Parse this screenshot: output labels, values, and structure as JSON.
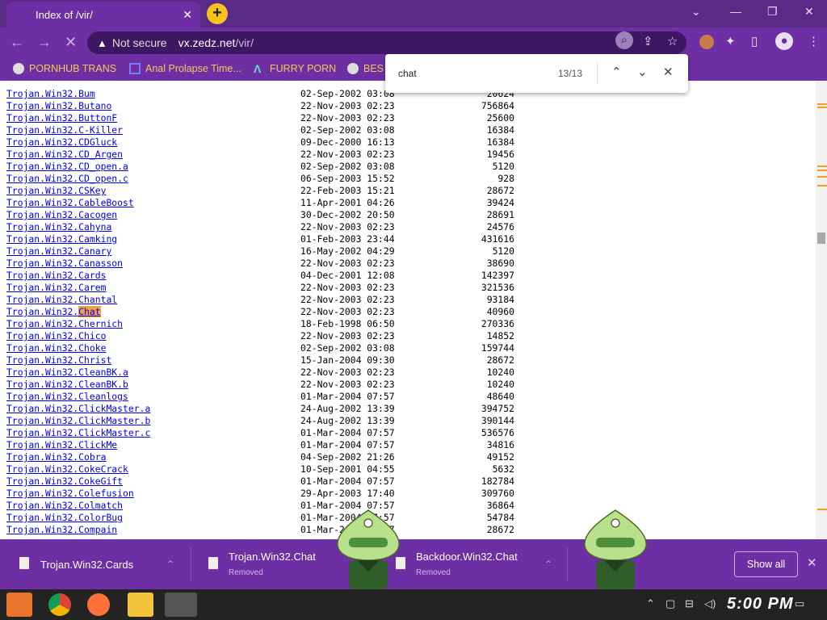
{
  "browser": {
    "tab_title": "Index of /vir/",
    "tab_close": "✕",
    "new_tab": "+",
    "not_secure": "Not secure",
    "url_host": "vx.zedz.net",
    "url_path": "/vir/"
  },
  "bookmarks": [
    {
      "label": "PORNHUB TRANS"
    },
    {
      "label": "Anal Prolapse Time..."
    },
    {
      "label": "FURRY PORN"
    },
    {
      "label": "BES"
    }
  ],
  "find": {
    "query": "chat",
    "count": "13/13"
  },
  "listing": [
    {
      "name": "Trojan.Win32.Bum",
      "date": "02-Sep-2002 03:08",
      "size": "20624"
    },
    {
      "name": "Trojan.Win32.Butano",
      "date": "22-Nov-2003 02:23",
      "size": "756864"
    },
    {
      "name": "Trojan.Win32.ButtonF",
      "date": "22-Nov-2003 02:23",
      "size": "25600"
    },
    {
      "name": "Trojan.Win32.C-Killer",
      "date": "02-Sep-2002 03:08",
      "size": "16384"
    },
    {
      "name": "Trojan.Win32.CDGluck",
      "date": "09-Dec-2000 16:13",
      "size": "16384"
    },
    {
      "name": "Trojan.Win32.CD_Argen",
      "date": "22-Nov-2003 02:23",
      "size": "19456"
    },
    {
      "name": "Trojan.Win32.CD_open.a",
      "date": "02-Sep-2002 03:08",
      "size": "5120"
    },
    {
      "name": "Trojan.Win32.CD_open.c",
      "date": "06-Sep-2003 15:52",
      "size": "928"
    },
    {
      "name": "Trojan.Win32.CSKey",
      "date": "22-Feb-2003 15:21",
      "size": "28672"
    },
    {
      "name": "Trojan.Win32.CableBoost",
      "date": "11-Apr-2001 04:26",
      "size": "39424"
    },
    {
      "name": "Trojan.Win32.Cacogen",
      "date": "30-Dec-2002 20:50",
      "size": "28691"
    },
    {
      "name": "Trojan.Win32.Cahyna",
      "date": "22-Nov-2003 02:23",
      "size": "24576"
    },
    {
      "name": "Trojan.Win32.Camking",
      "date": "01-Feb-2003 23:44",
      "size": "431616"
    },
    {
      "name": "Trojan.Win32.Canary",
      "date": "16-May-2002 04:29",
      "size": "5120"
    },
    {
      "name": "Trojan.Win32.Canasson",
      "date": "22-Nov-2003 02:23",
      "size": "38690"
    },
    {
      "name": "Trojan.Win32.Cards",
      "date": "04-Dec-2001 12:08",
      "size": "142397"
    },
    {
      "name": "Trojan.Win32.Carem",
      "date": "22-Nov-2003 02:23",
      "size": "321536"
    },
    {
      "name": "Trojan.Win32.Chantal",
      "date": "22-Nov-2003 02:23",
      "size": "93184"
    },
    {
      "name": "Trojan.Win32.Chat",
      "date": "22-Nov-2003 02:23",
      "size": "40960",
      "highlight": "Chat"
    },
    {
      "name": "Trojan.Win32.Chernich",
      "date": "18-Feb-1998 06:50",
      "size": "270336"
    },
    {
      "name": "Trojan.Win32.Chico",
      "date": "22-Nov-2003 02:23",
      "size": "14852"
    },
    {
      "name": "Trojan.Win32.Choke",
      "date": "02-Sep-2002 03:08",
      "size": "159744"
    },
    {
      "name": "Trojan.Win32.Christ",
      "date": "15-Jan-2004 09:30",
      "size": "28672"
    },
    {
      "name": "Trojan.Win32.CleanBK.a",
      "date": "22-Nov-2003 02:23",
      "size": "10240"
    },
    {
      "name": "Trojan.Win32.CleanBK.b",
      "date": "22-Nov-2003 02:23",
      "size": "10240"
    },
    {
      "name": "Trojan.Win32.Cleanlogs",
      "date": "01-Mar-2004 07:57",
      "size": "48640"
    },
    {
      "name": "Trojan.Win32.ClickMaster.a",
      "date": "24-Aug-2002 13:39",
      "size": "394752"
    },
    {
      "name": "Trojan.Win32.ClickMaster.b",
      "date": "24-Aug-2002 13:39",
      "size": "390144"
    },
    {
      "name": "Trojan.Win32.ClickMaster.c",
      "date": "01-Mar-2004 07:57",
      "size": "536576"
    },
    {
      "name": "Trojan.Win32.ClickMe",
      "date": "01-Mar-2004 07:57",
      "size": "34816"
    },
    {
      "name": "Trojan.Win32.Cobra",
      "date": "04-Sep-2002 21:26",
      "size": "49152"
    },
    {
      "name": "Trojan.Win32.CokeCrack",
      "date": "10-Sep-2001 04:55",
      "size": "5632"
    },
    {
      "name": "Trojan.Win32.CokeGift",
      "date": "01-Mar-2004 07:57",
      "size": "182784"
    },
    {
      "name": "Trojan.Win32.Colefusion",
      "date": "29-Apr-2003 17:40",
      "size": "309760"
    },
    {
      "name": "Trojan.Win32.Colmatch",
      "date": "01-Mar-2004 07:57",
      "size": "36864"
    },
    {
      "name": "Trojan.Win32.ColorBug",
      "date": "01-Mar-2004 07:57",
      "size": "54784"
    },
    {
      "name": "Trojan.Win32.Compain",
      "date": "01-Mar-2004 07:57",
      "size": "28672"
    }
  ],
  "downloads": [
    {
      "name": "Trojan.Win32.Cards",
      "status": ""
    },
    {
      "name": "Trojan.Win32.Chat",
      "status": "Removed"
    },
    {
      "name": "Backdoor.Win32.Chat",
      "status": "Removed"
    }
  ],
  "downloads_show_all": "Show all",
  "taskbar": {
    "clock": "5:00 PM"
  },
  "colors": {
    "accent": "#6d2fa3",
    "link": "#0000ee",
    "find_highlight": "#f5a142"
  }
}
